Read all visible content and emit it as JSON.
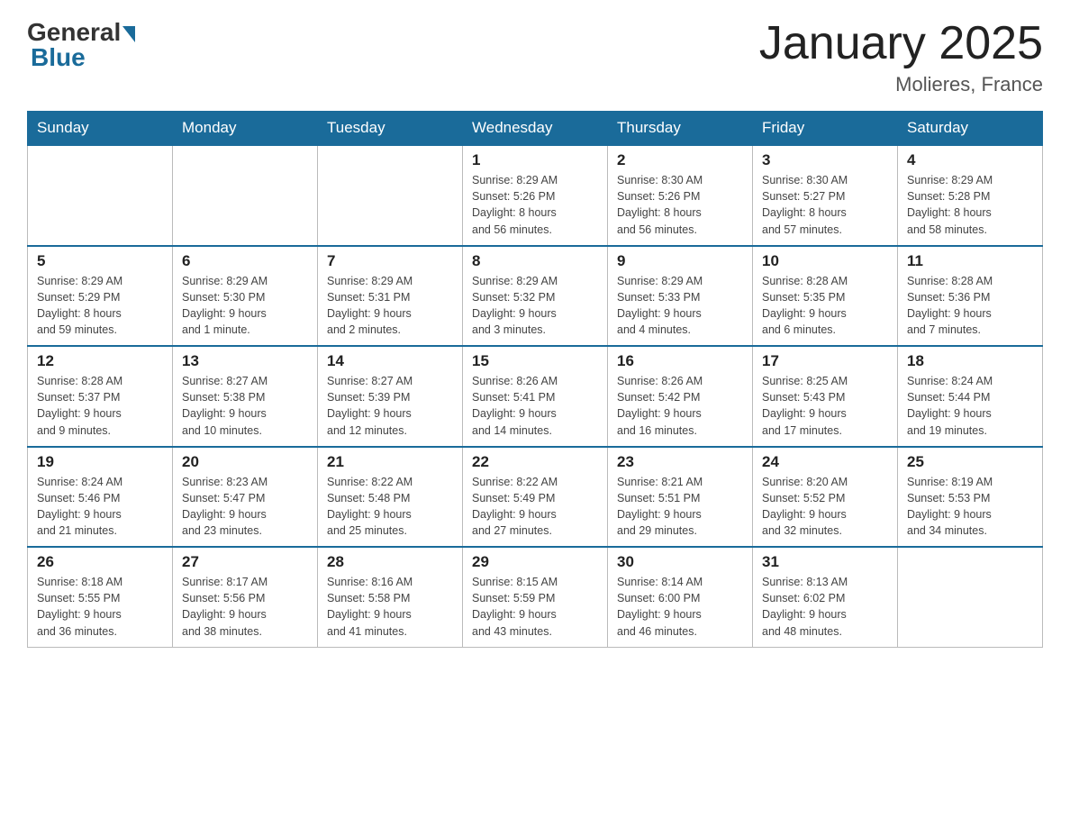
{
  "header": {
    "logo_general": "General",
    "logo_blue": "Blue",
    "title": "January 2025",
    "subtitle": "Molieres, France"
  },
  "weekdays": [
    "Sunday",
    "Monday",
    "Tuesday",
    "Wednesday",
    "Thursday",
    "Friday",
    "Saturday"
  ],
  "weeks": [
    [
      {
        "day": "",
        "info": ""
      },
      {
        "day": "",
        "info": ""
      },
      {
        "day": "",
        "info": ""
      },
      {
        "day": "1",
        "info": "Sunrise: 8:29 AM\nSunset: 5:26 PM\nDaylight: 8 hours\nand 56 minutes."
      },
      {
        "day": "2",
        "info": "Sunrise: 8:30 AM\nSunset: 5:26 PM\nDaylight: 8 hours\nand 56 minutes."
      },
      {
        "day": "3",
        "info": "Sunrise: 8:30 AM\nSunset: 5:27 PM\nDaylight: 8 hours\nand 57 minutes."
      },
      {
        "day": "4",
        "info": "Sunrise: 8:29 AM\nSunset: 5:28 PM\nDaylight: 8 hours\nand 58 minutes."
      }
    ],
    [
      {
        "day": "5",
        "info": "Sunrise: 8:29 AM\nSunset: 5:29 PM\nDaylight: 8 hours\nand 59 minutes."
      },
      {
        "day": "6",
        "info": "Sunrise: 8:29 AM\nSunset: 5:30 PM\nDaylight: 9 hours\nand 1 minute."
      },
      {
        "day": "7",
        "info": "Sunrise: 8:29 AM\nSunset: 5:31 PM\nDaylight: 9 hours\nand 2 minutes."
      },
      {
        "day": "8",
        "info": "Sunrise: 8:29 AM\nSunset: 5:32 PM\nDaylight: 9 hours\nand 3 minutes."
      },
      {
        "day": "9",
        "info": "Sunrise: 8:29 AM\nSunset: 5:33 PM\nDaylight: 9 hours\nand 4 minutes."
      },
      {
        "day": "10",
        "info": "Sunrise: 8:28 AM\nSunset: 5:35 PM\nDaylight: 9 hours\nand 6 minutes."
      },
      {
        "day": "11",
        "info": "Sunrise: 8:28 AM\nSunset: 5:36 PM\nDaylight: 9 hours\nand 7 minutes."
      }
    ],
    [
      {
        "day": "12",
        "info": "Sunrise: 8:28 AM\nSunset: 5:37 PM\nDaylight: 9 hours\nand 9 minutes."
      },
      {
        "day": "13",
        "info": "Sunrise: 8:27 AM\nSunset: 5:38 PM\nDaylight: 9 hours\nand 10 minutes."
      },
      {
        "day": "14",
        "info": "Sunrise: 8:27 AM\nSunset: 5:39 PM\nDaylight: 9 hours\nand 12 minutes."
      },
      {
        "day": "15",
        "info": "Sunrise: 8:26 AM\nSunset: 5:41 PM\nDaylight: 9 hours\nand 14 minutes."
      },
      {
        "day": "16",
        "info": "Sunrise: 8:26 AM\nSunset: 5:42 PM\nDaylight: 9 hours\nand 16 minutes."
      },
      {
        "day": "17",
        "info": "Sunrise: 8:25 AM\nSunset: 5:43 PM\nDaylight: 9 hours\nand 17 minutes."
      },
      {
        "day": "18",
        "info": "Sunrise: 8:24 AM\nSunset: 5:44 PM\nDaylight: 9 hours\nand 19 minutes."
      }
    ],
    [
      {
        "day": "19",
        "info": "Sunrise: 8:24 AM\nSunset: 5:46 PM\nDaylight: 9 hours\nand 21 minutes."
      },
      {
        "day": "20",
        "info": "Sunrise: 8:23 AM\nSunset: 5:47 PM\nDaylight: 9 hours\nand 23 minutes."
      },
      {
        "day": "21",
        "info": "Sunrise: 8:22 AM\nSunset: 5:48 PM\nDaylight: 9 hours\nand 25 minutes."
      },
      {
        "day": "22",
        "info": "Sunrise: 8:22 AM\nSunset: 5:49 PM\nDaylight: 9 hours\nand 27 minutes."
      },
      {
        "day": "23",
        "info": "Sunrise: 8:21 AM\nSunset: 5:51 PM\nDaylight: 9 hours\nand 29 minutes."
      },
      {
        "day": "24",
        "info": "Sunrise: 8:20 AM\nSunset: 5:52 PM\nDaylight: 9 hours\nand 32 minutes."
      },
      {
        "day": "25",
        "info": "Sunrise: 8:19 AM\nSunset: 5:53 PM\nDaylight: 9 hours\nand 34 minutes."
      }
    ],
    [
      {
        "day": "26",
        "info": "Sunrise: 8:18 AM\nSunset: 5:55 PM\nDaylight: 9 hours\nand 36 minutes."
      },
      {
        "day": "27",
        "info": "Sunrise: 8:17 AM\nSunset: 5:56 PM\nDaylight: 9 hours\nand 38 minutes."
      },
      {
        "day": "28",
        "info": "Sunrise: 8:16 AM\nSunset: 5:58 PM\nDaylight: 9 hours\nand 41 minutes."
      },
      {
        "day": "29",
        "info": "Sunrise: 8:15 AM\nSunset: 5:59 PM\nDaylight: 9 hours\nand 43 minutes."
      },
      {
        "day": "30",
        "info": "Sunrise: 8:14 AM\nSunset: 6:00 PM\nDaylight: 9 hours\nand 46 minutes."
      },
      {
        "day": "31",
        "info": "Sunrise: 8:13 AM\nSunset: 6:02 PM\nDaylight: 9 hours\nand 48 minutes."
      },
      {
        "day": "",
        "info": ""
      }
    ]
  ]
}
